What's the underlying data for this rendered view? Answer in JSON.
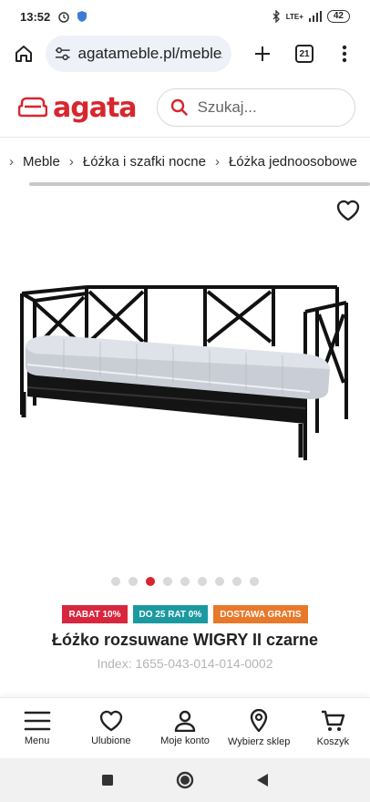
{
  "status_bar": {
    "time": "13:52",
    "network": "LTE+",
    "battery": "42"
  },
  "browser": {
    "url": "agatameble.pl/meble/",
    "tab_count": "21"
  },
  "header": {
    "logo_text": "agata",
    "search_placeholder": "Szukaj..."
  },
  "breadcrumb": {
    "items": [
      "Meble",
      "Łóżka i szafki nocne",
      "Łóżka jednoosobowe"
    ]
  },
  "gallery": {
    "dot_count": 9,
    "active_index": 2
  },
  "badges": [
    {
      "label": "RABAT 10%",
      "color": "#d8263e"
    },
    {
      "label": "DO 25 RAT 0%",
      "color": "#1a9aa0"
    },
    {
      "label": "DOSTAWA GRATIS",
      "color": "#e8782a"
    }
  ],
  "product": {
    "title": "Łóżko rozsuwane WIGRY II czarne",
    "index": "Index: 1655-043-014-014-0002"
  },
  "bottom_nav": [
    {
      "label": "Menu",
      "icon": "menu-icon"
    },
    {
      "label": "Ulubione",
      "icon": "heart-icon"
    },
    {
      "label": "Moje konto",
      "icon": "user-icon"
    },
    {
      "label": "Wybierz sklep",
      "icon": "location-pin-icon"
    },
    {
      "label": "Koszyk",
      "icon": "cart-icon"
    }
  ],
  "colors": {
    "brand": "#d8262e"
  }
}
